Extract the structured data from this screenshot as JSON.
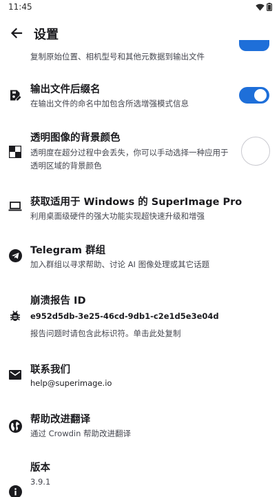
{
  "status": {
    "time": "11:45"
  },
  "app_bar": {
    "title": "设置",
    "back_icon": "arrow-left-icon"
  },
  "partial_item": {
    "subtitle": "复制原始位置、相机型号和其他元数据到输出文件"
  },
  "settings": [
    {
      "key": "suffix",
      "icon": "file-edit-icon",
      "title": "输出文件后缀名",
      "subtitle": "在输出文件的命名中加包含所选增强模式信息",
      "toggle": true
    },
    {
      "key": "bgcolor",
      "icon": "checkerboard-icon",
      "title": "透明图像的背景颜色",
      "subtitle": "透明度在超分过程中会丢失，你可以手动选择一种应用于透明区域的背景颜色",
      "selected_color": "#ffffff"
    },
    {
      "key": "windows",
      "icon": "laptop-icon",
      "title": "获取适用于 Windows 的 SuperImage Pro",
      "subtitle": "利用桌面级硬件的强大功能实现超快速升级和增强"
    },
    {
      "key": "telegram",
      "icon": "telegram-icon",
      "title": "Telegram 群组",
      "subtitle": "加入群组以寻求帮助、讨论 AI 图像处理或其它话题"
    },
    {
      "key": "crash",
      "icon": "bug-icon",
      "title": "崩溃报告 ID",
      "value": "e952d5db-3e25-46cd-9db1-c2e1d5e3e04d",
      "subtitle": "报告问题时请包含此标识符。单击此处复制"
    },
    {
      "key": "contact",
      "icon": "mail-icon",
      "title": "联系我们",
      "value": "help@superimage.io"
    },
    {
      "key": "translate",
      "icon": "globe-icon",
      "title": "帮助改进翻译",
      "subtitle": "通过 Crowdin 帮助改进翻译"
    },
    {
      "key": "version",
      "icon": "info-icon",
      "title": "版本",
      "subtitle": "3.9.1"
    }
  ],
  "colors": {
    "accent": "#1e6fd9",
    "text": "#1b1b1f",
    "secondary": "#44464f"
  }
}
